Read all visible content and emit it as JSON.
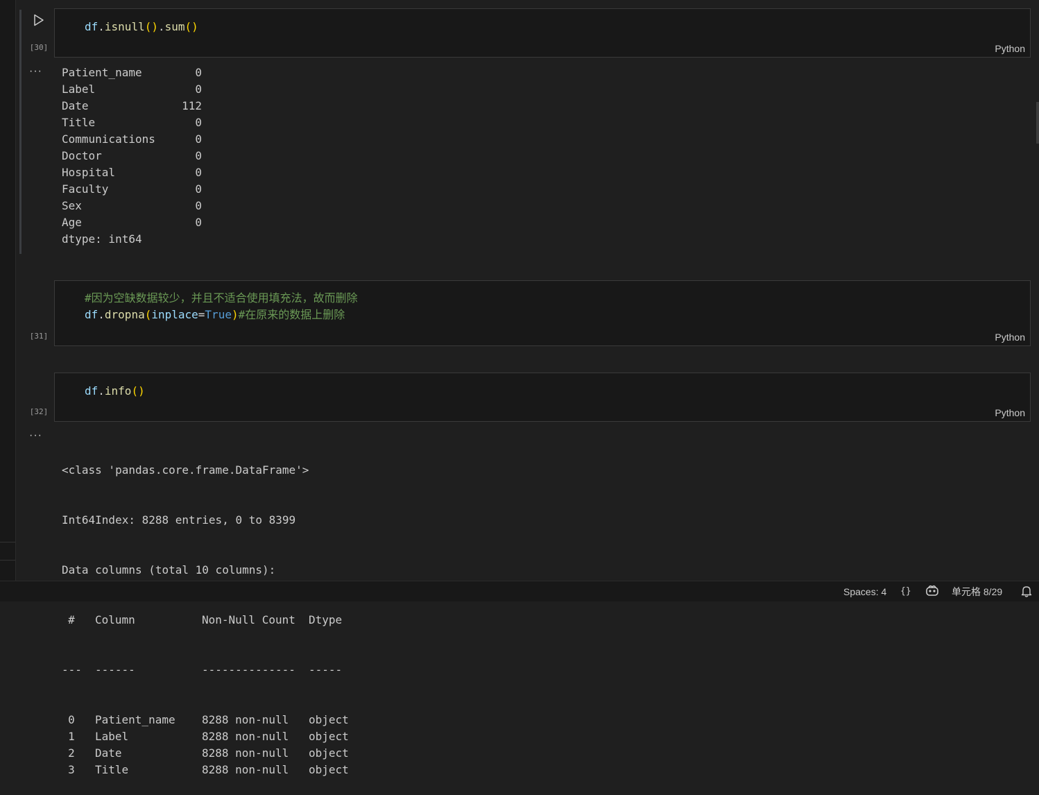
{
  "cells": [
    {
      "exec_count": "[30]",
      "language": "Python",
      "code_fn1": "isnull",
      "code_fn2": "sum"
    },
    {
      "exec_count": "[31]",
      "language": "Python",
      "comment1": "#因为空缺数据较少，并且不适合使用填充法，故而删除",
      "param": "inplace",
      "value": "True",
      "comment2": "#在原来的数据上删除"
    },
    {
      "exec_count": "[32]",
      "language": "Python",
      "code_fn": "info"
    }
  ],
  "code_var": "df",
  "output_more": "···",
  "null_counts": {
    "rows": [
      {
        "name": "Patient_name",
        "value": "0"
      },
      {
        "name": "Label",
        "value": "0"
      },
      {
        "name": "Date",
        "value": "112"
      },
      {
        "name": "Title",
        "value": "0"
      },
      {
        "name": "Communications",
        "value": "0"
      },
      {
        "name": "Doctor",
        "value": "0"
      },
      {
        "name": "Hospital",
        "value": "0"
      },
      {
        "name": "Faculty",
        "value": "0"
      },
      {
        "name": "Sex",
        "value": "0"
      },
      {
        "name": "Age",
        "value": "0"
      }
    ],
    "dtype_line": "dtype: int64"
  },
  "info_output": {
    "class_line": "<class 'pandas.core.frame.DataFrame'>",
    "index_line": "Int64Index: 8288 entries, 0 to 8399",
    "columns_line": "Data columns (total 10 columns):",
    "header": {
      "num": "#",
      "column": "Column",
      "nonnull": "Non-Null Count",
      "dtype": "Dtype"
    },
    "separator": {
      "num": "---",
      "column": "------",
      "nonnull": "--------------",
      "dtype": "-----"
    },
    "rows": [
      {
        "num": "0",
        "column": "Patient_name",
        "nonnull": "8288 non-null",
        "dtype": "object"
      },
      {
        "num": "1",
        "column": "Label",
        "nonnull": "8288 non-null",
        "dtype": "object"
      },
      {
        "num": "2",
        "column": "Date",
        "nonnull": "8288 non-null",
        "dtype": "object"
      },
      {
        "num": "3",
        "column": "Title",
        "nonnull": "8288 non-null",
        "dtype": "object"
      }
    ]
  },
  "statusbar": {
    "spaces": "Spaces: 4",
    "braces": "{}",
    "cell_position": "单元格 8/29"
  },
  "colors": {
    "background": "#1f1f1f",
    "cell_background": "#181818",
    "variable": "#9cdcfe",
    "function": "#dcdcaa",
    "paren": "#ffd700",
    "keyword": "#569cd6",
    "comment": "#6a9955"
  }
}
